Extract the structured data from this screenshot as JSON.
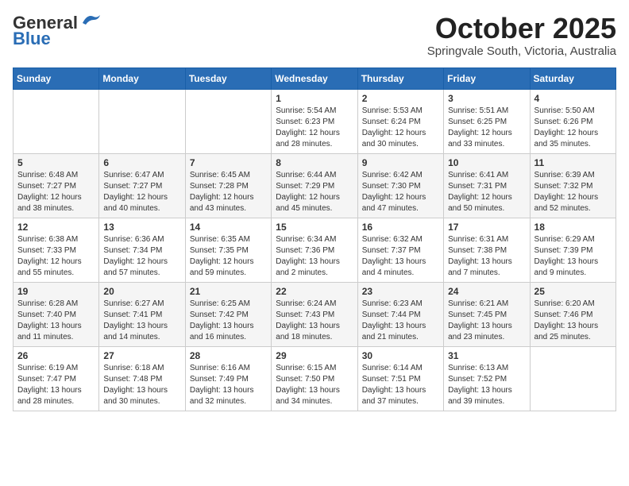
{
  "header": {
    "logo_general": "General",
    "logo_blue": "Blue",
    "month_title": "October 2025",
    "subtitle": "Springvale South, Victoria, Australia"
  },
  "weekdays": [
    "Sunday",
    "Monday",
    "Tuesday",
    "Wednesday",
    "Thursday",
    "Friday",
    "Saturday"
  ],
  "weeks": [
    [
      {
        "day": "",
        "info": ""
      },
      {
        "day": "",
        "info": ""
      },
      {
        "day": "",
        "info": ""
      },
      {
        "day": "1",
        "info": "Sunrise: 5:54 AM\nSunset: 6:23 PM\nDaylight: 12 hours\nand 28 minutes."
      },
      {
        "day": "2",
        "info": "Sunrise: 5:53 AM\nSunset: 6:24 PM\nDaylight: 12 hours\nand 30 minutes."
      },
      {
        "day": "3",
        "info": "Sunrise: 5:51 AM\nSunset: 6:25 PM\nDaylight: 12 hours\nand 33 minutes."
      },
      {
        "day": "4",
        "info": "Sunrise: 5:50 AM\nSunset: 6:26 PM\nDaylight: 12 hours\nand 35 minutes."
      }
    ],
    [
      {
        "day": "5",
        "info": "Sunrise: 6:48 AM\nSunset: 7:27 PM\nDaylight: 12 hours\nand 38 minutes."
      },
      {
        "day": "6",
        "info": "Sunrise: 6:47 AM\nSunset: 7:27 PM\nDaylight: 12 hours\nand 40 minutes."
      },
      {
        "day": "7",
        "info": "Sunrise: 6:45 AM\nSunset: 7:28 PM\nDaylight: 12 hours\nand 43 minutes."
      },
      {
        "day": "8",
        "info": "Sunrise: 6:44 AM\nSunset: 7:29 PM\nDaylight: 12 hours\nand 45 minutes."
      },
      {
        "day": "9",
        "info": "Sunrise: 6:42 AM\nSunset: 7:30 PM\nDaylight: 12 hours\nand 47 minutes."
      },
      {
        "day": "10",
        "info": "Sunrise: 6:41 AM\nSunset: 7:31 PM\nDaylight: 12 hours\nand 50 minutes."
      },
      {
        "day": "11",
        "info": "Sunrise: 6:39 AM\nSunset: 7:32 PM\nDaylight: 12 hours\nand 52 minutes."
      }
    ],
    [
      {
        "day": "12",
        "info": "Sunrise: 6:38 AM\nSunset: 7:33 PM\nDaylight: 12 hours\nand 55 minutes."
      },
      {
        "day": "13",
        "info": "Sunrise: 6:36 AM\nSunset: 7:34 PM\nDaylight: 12 hours\nand 57 minutes."
      },
      {
        "day": "14",
        "info": "Sunrise: 6:35 AM\nSunset: 7:35 PM\nDaylight: 12 hours\nand 59 minutes."
      },
      {
        "day": "15",
        "info": "Sunrise: 6:34 AM\nSunset: 7:36 PM\nDaylight: 13 hours\nand 2 minutes."
      },
      {
        "day": "16",
        "info": "Sunrise: 6:32 AM\nSunset: 7:37 PM\nDaylight: 13 hours\nand 4 minutes."
      },
      {
        "day": "17",
        "info": "Sunrise: 6:31 AM\nSunset: 7:38 PM\nDaylight: 13 hours\nand 7 minutes."
      },
      {
        "day": "18",
        "info": "Sunrise: 6:29 AM\nSunset: 7:39 PM\nDaylight: 13 hours\nand 9 minutes."
      }
    ],
    [
      {
        "day": "19",
        "info": "Sunrise: 6:28 AM\nSunset: 7:40 PM\nDaylight: 13 hours\nand 11 minutes."
      },
      {
        "day": "20",
        "info": "Sunrise: 6:27 AM\nSunset: 7:41 PM\nDaylight: 13 hours\nand 14 minutes."
      },
      {
        "day": "21",
        "info": "Sunrise: 6:25 AM\nSunset: 7:42 PM\nDaylight: 13 hours\nand 16 minutes."
      },
      {
        "day": "22",
        "info": "Sunrise: 6:24 AM\nSunset: 7:43 PM\nDaylight: 13 hours\nand 18 minutes."
      },
      {
        "day": "23",
        "info": "Sunrise: 6:23 AM\nSunset: 7:44 PM\nDaylight: 13 hours\nand 21 minutes."
      },
      {
        "day": "24",
        "info": "Sunrise: 6:21 AM\nSunset: 7:45 PM\nDaylight: 13 hours\nand 23 minutes."
      },
      {
        "day": "25",
        "info": "Sunrise: 6:20 AM\nSunset: 7:46 PM\nDaylight: 13 hours\nand 25 minutes."
      }
    ],
    [
      {
        "day": "26",
        "info": "Sunrise: 6:19 AM\nSunset: 7:47 PM\nDaylight: 13 hours\nand 28 minutes."
      },
      {
        "day": "27",
        "info": "Sunrise: 6:18 AM\nSunset: 7:48 PM\nDaylight: 13 hours\nand 30 minutes."
      },
      {
        "day": "28",
        "info": "Sunrise: 6:16 AM\nSunset: 7:49 PM\nDaylight: 13 hours\nand 32 minutes."
      },
      {
        "day": "29",
        "info": "Sunrise: 6:15 AM\nSunset: 7:50 PM\nDaylight: 13 hours\nand 34 minutes."
      },
      {
        "day": "30",
        "info": "Sunrise: 6:14 AM\nSunset: 7:51 PM\nDaylight: 13 hours\nand 37 minutes."
      },
      {
        "day": "31",
        "info": "Sunrise: 6:13 AM\nSunset: 7:52 PM\nDaylight: 13 hours\nand 39 minutes."
      },
      {
        "day": "",
        "info": ""
      }
    ]
  ]
}
